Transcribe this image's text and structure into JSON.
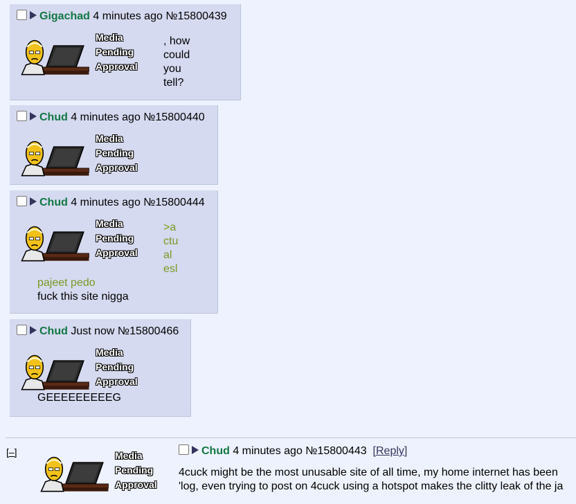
{
  "thumbnail_label": [
    "Media",
    "Pending",
    "Approval"
  ],
  "posts": [
    {
      "name": "Gigachad",
      "time": "4 minutes ago",
      "number": "№15800439",
      "side_lines": [
        ", how",
        "could",
        "you",
        "tell?"
      ]
    },
    {
      "name": "Chud",
      "time": "4 minutes ago",
      "number": "№15800440"
    },
    {
      "name": "Chud",
      "time": "4 minutes ago",
      "number": "№15800444",
      "side_quote": [
        ">a",
        "ctu",
        "al",
        "esl"
      ],
      "quote_line": "pajeet pedo",
      "text_line": "fuck this site nigga"
    },
    {
      "name": "Chud",
      "time": "Just now",
      "number": "№15800466",
      "text_line": "GEEEEEEEEEG"
    }
  ],
  "thread": {
    "toggle": "[–]",
    "name": "Chud",
    "time": "4 minutes ago",
    "number": "№15800443",
    "reply": "[Reply]",
    "line1": "4cuck might be the most unusable site of all time, my home internet has been",
    "line2": "'log, even trying to post on 4cuck using a hotspot makes the clitty leak of the ja"
  },
  "colors": {
    "post_bg": "#d6daf0",
    "page_bg": "#eef2ff",
    "name": "#117743",
    "quote": "#789922",
    "border": "#b7c5d9"
  }
}
